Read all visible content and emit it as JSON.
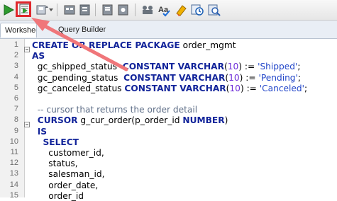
{
  "toolbar": {
    "icons": [
      "run-statement-icon",
      "run-script-icon",
      "commit-icon",
      "rollback-icon",
      "explain-plan-icon",
      "autotrace-icon",
      "sql-tuning-icon",
      "clear-icon",
      "format-icon",
      "spell-check-icon",
      "eraser-icon",
      "history-icon",
      "find-icon"
    ],
    "highlight_color": "#e0272c"
  },
  "tabs": [
    {
      "label": "Worksheet",
      "active": true
    },
    {
      "label": "Query Builder",
      "active": false
    }
  ],
  "editor": {
    "line_numbers": [
      "1",
      "2",
      "3",
      "4",
      "5",
      "6",
      "7",
      "8",
      "9",
      "10",
      "11",
      "12",
      "13",
      "14",
      "15"
    ],
    "lines": [
      {
        "parts": [
          {
            "t": "kw",
            "s": "CREATE OR REPLACE PACKAGE"
          },
          {
            "t": "pl",
            "s": " order_mgmt"
          }
        ]
      },
      {
        "parts": [
          {
            "t": "kw",
            "s": "AS"
          }
        ]
      },
      {
        "parts": [
          {
            "t": "pl",
            "s": "  gc_shipped_status  "
          },
          {
            "t": "kw",
            "s": "CONSTANT VARCHAR"
          },
          {
            "t": "pl",
            "s": "("
          },
          {
            "t": "num",
            "s": "10"
          },
          {
            "t": "pl",
            "s": ") := "
          },
          {
            "t": "str",
            "s": "'Shipped'"
          },
          {
            "t": "pl",
            "s": ";"
          }
        ]
      },
      {
        "parts": [
          {
            "t": "pl",
            "s": "  gc_pending_status  "
          },
          {
            "t": "kw",
            "s": "CONSTANT VARCHAR"
          },
          {
            "t": "pl",
            "s": "("
          },
          {
            "t": "num",
            "s": "10"
          },
          {
            "t": "pl",
            "s": ") := "
          },
          {
            "t": "str",
            "s": "'Pending'"
          },
          {
            "t": "pl",
            "s": ";"
          }
        ]
      },
      {
        "parts": [
          {
            "t": "pl",
            "s": "  gc_canceled_status "
          },
          {
            "t": "kw",
            "s": "CONSTANT VARCHAR"
          },
          {
            "t": "pl",
            "s": "("
          },
          {
            "t": "num",
            "s": "10"
          },
          {
            "t": "pl",
            "s": ") := "
          },
          {
            "t": "str",
            "s": "'Canceled'"
          },
          {
            "t": "pl",
            "s": ";"
          }
        ]
      },
      {
        "parts": []
      },
      {
        "parts": [
          {
            "t": "cm",
            "s": "  -- cursor that returns the order detail"
          }
        ]
      },
      {
        "parts": [
          {
            "t": "pl",
            "s": "  "
          },
          {
            "t": "kw",
            "s": "CURSOR"
          },
          {
            "t": "pl",
            "s": " g_cur_order(p_order_id "
          },
          {
            "t": "kw",
            "s": "NUMBER"
          },
          {
            "t": "pl",
            "s": ")"
          }
        ]
      },
      {
        "parts": [
          {
            "t": "pl",
            "s": "  "
          },
          {
            "t": "kw",
            "s": "IS"
          }
        ]
      },
      {
        "parts": [
          {
            "t": "pl",
            "s": "    "
          },
          {
            "t": "kw",
            "s": "SELECT"
          }
        ]
      },
      {
        "parts": [
          {
            "t": "pl",
            "s": "      customer_id,"
          }
        ]
      },
      {
        "parts": [
          {
            "t": "pl",
            "s": "      status,"
          }
        ]
      },
      {
        "parts": [
          {
            "t": "pl",
            "s": "      salesman_id,"
          }
        ]
      },
      {
        "parts": [
          {
            "t": "pl",
            "s": "      order_date,"
          }
        ]
      },
      {
        "parts": [
          {
            "t": "pl",
            "s": "      order_id"
          }
        ]
      }
    ]
  }
}
